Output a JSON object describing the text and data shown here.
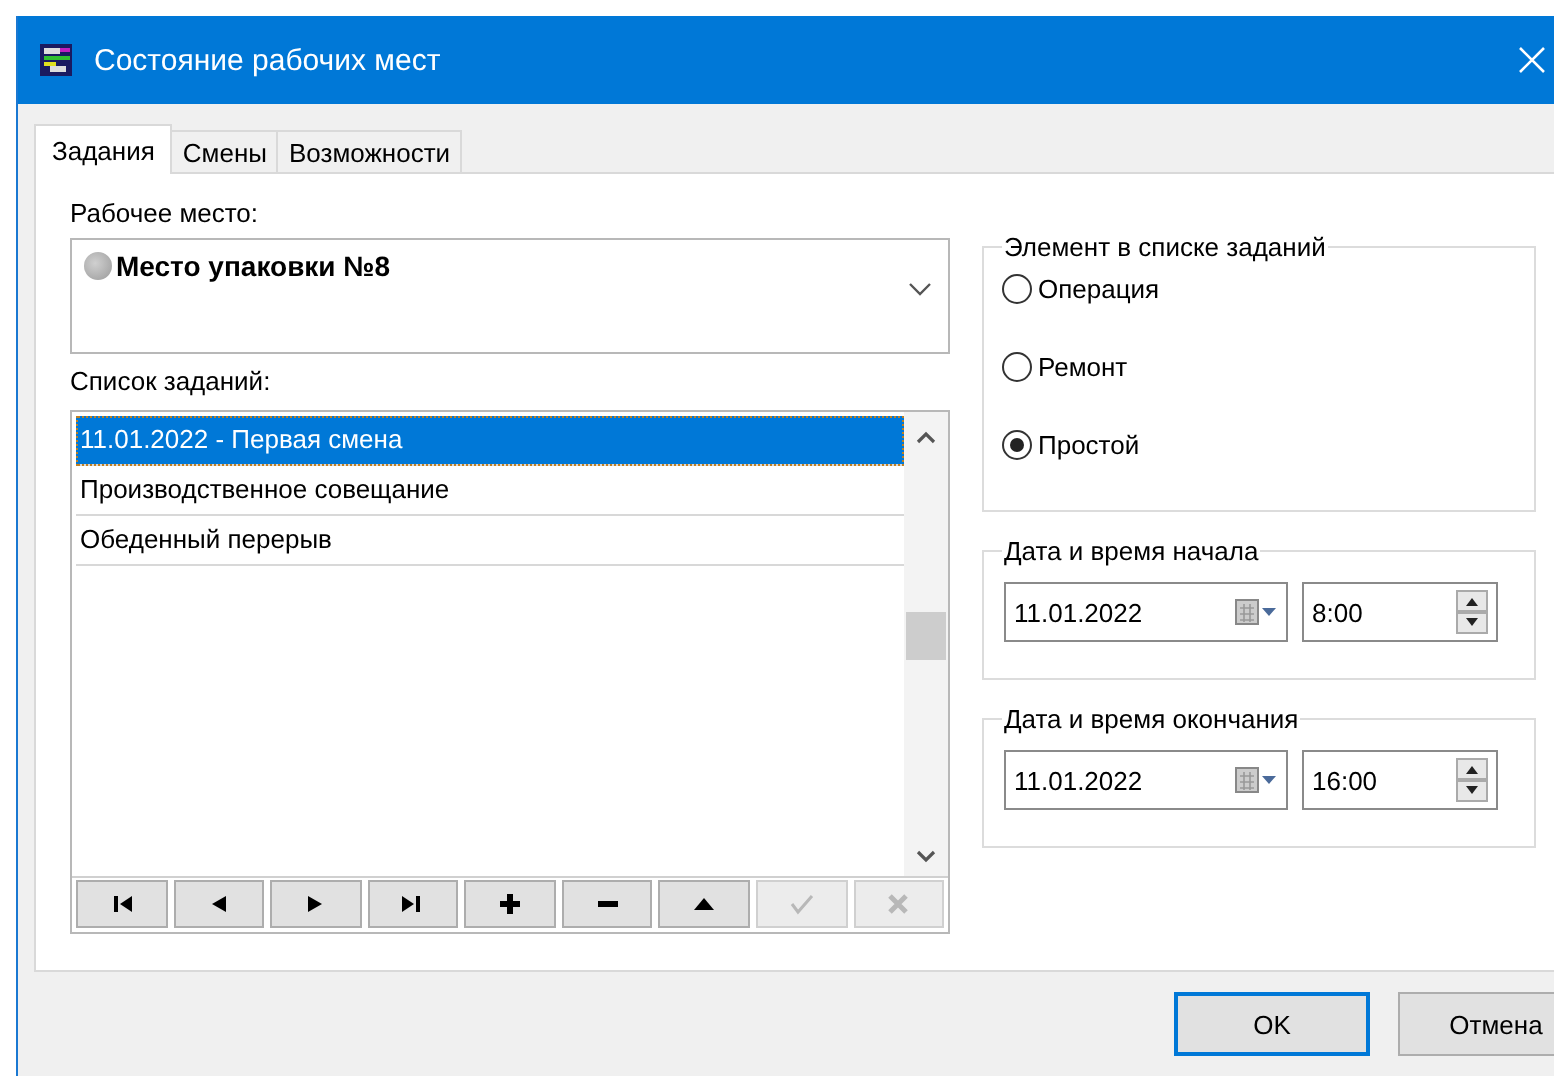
{
  "window": {
    "title": "Состояние рабочих мест"
  },
  "tabs": [
    {
      "label": "Задания",
      "selected": true
    },
    {
      "label": "Смены",
      "selected": false
    },
    {
      "label": "Возможности",
      "selected": false
    }
  ],
  "workplace": {
    "label": "Рабочее место:",
    "value": "Место упаковки №8"
  },
  "tasks": {
    "label": "Список заданий:",
    "rows": [
      {
        "text": "11.01.2022 - Первая смена",
        "selected": true
      },
      {
        "text": "Производственное совещание",
        "selected": false
      },
      {
        "text": "Обеденный перерыв",
        "selected": false
      }
    ],
    "nav_buttons": [
      {
        "kind": "first",
        "disabled": false
      },
      {
        "kind": "prior",
        "disabled": false
      },
      {
        "kind": "next",
        "disabled": false
      },
      {
        "kind": "last",
        "disabled": false
      },
      {
        "kind": "insert",
        "disabled": false
      },
      {
        "kind": "delete",
        "disabled": false
      },
      {
        "kind": "edit",
        "disabled": false
      },
      {
        "kind": "post",
        "disabled": true
      },
      {
        "kind": "cancel",
        "disabled": true
      }
    ]
  },
  "element_group": {
    "title": "Элемент в списке заданий",
    "options": [
      {
        "label": "Операция",
        "selected": false
      },
      {
        "label": "Ремонт",
        "selected": false
      },
      {
        "label": "Простой",
        "selected": true
      }
    ]
  },
  "start": {
    "title": "Дата и время начала",
    "date": "11.01.2022",
    "time": "8:00"
  },
  "end": {
    "title": "Дата и время окончания",
    "date": "11.01.2022",
    "time": "16:00"
  },
  "buttons": [
    {
      "label": "OK",
      "default": true
    },
    {
      "label": "Отмена",
      "default": false
    }
  ]
}
